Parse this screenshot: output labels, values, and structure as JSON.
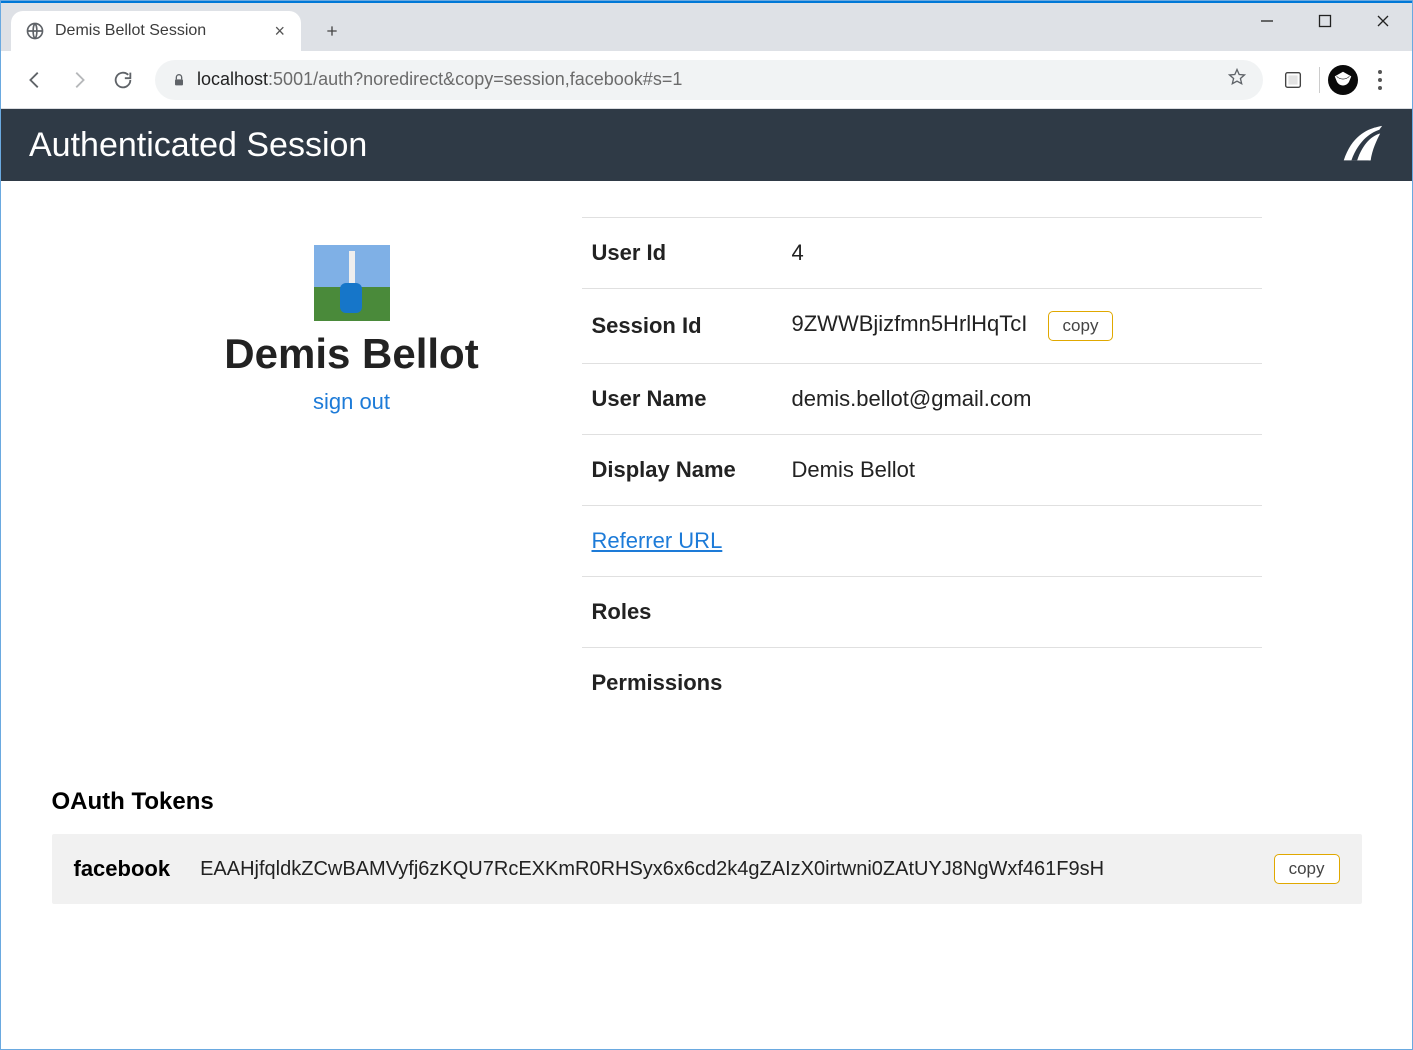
{
  "browser": {
    "tab_title": "Demis Bellot Session",
    "url_host": "localhost",
    "url_rest": ":5001/auth?noredirect&copy=session,facebook#s=1"
  },
  "header": {
    "title": "Authenticated Session"
  },
  "profile": {
    "display_name": "Demis Bellot",
    "sign_out": "sign out"
  },
  "details": {
    "rows": [
      {
        "label": "User Id",
        "value": "4"
      },
      {
        "label": "Session Id",
        "value": "9ZWWBjizfmn5HrlHqTcI",
        "copy": true
      },
      {
        "label": "User Name",
        "value": "demis.bellot@gmail.com"
      },
      {
        "label": "Display Name",
        "value": "Demis Bellot"
      }
    ],
    "referrer_label": "Referrer URL",
    "roles_label": "Roles",
    "permissions_label": "Permissions",
    "copy_label": "copy"
  },
  "oauth": {
    "heading": "OAuth Tokens",
    "provider": "facebook",
    "token": "EAAHjfqldkZCwBAMVyfj6zKQU7RcEXKmR0RHSyx6x6cd2k4gZAIzX0irtwni0ZAtUYJ8NgWxf461F9sH",
    "copy_label": "copy"
  }
}
